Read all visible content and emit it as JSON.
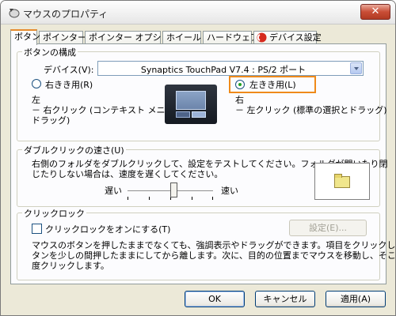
{
  "window": {
    "title": "マウスのプロパティ",
    "close_label": "✕"
  },
  "tabs": [
    {
      "label": "ボタン",
      "active": true
    },
    {
      "label": "ポインター"
    },
    {
      "label": "ポインター オプション"
    },
    {
      "label": "ホイール"
    },
    {
      "label": "ハードウェア"
    },
    {
      "label": "デバイス設定"
    }
  ],
  "buttons_group": {
    "legend": "ボタンの構成",
    "device_label": "デバイス(V):",
    "device_value": "Synaptics TouchPad V7.4 : PS/2 ポート",
    "right_handed_label": "右きき用(R)",
    "left_handed_label": "左きき用(L)",
    "left_mapping_title": "左",
    "left_mapping_line1": "－ 右クリック (コンテキスト メニューと補助",
    "left_mapping_line2": "ドラッグ)",
    "right_mapping_title": "右",
    "right_mapping_line1": "－ 左クリック (標準の選択とドラッグ)"
  },
  "double_click": {
    "legend": "ダブルクリックの速さ(U)",
    "description_line1": "右側のフォルダをダブルクリックして、設定をテストしてください。フォルダが開いたり閉",
    "description_line2": "じたりしない場合は、速度を遅くしてください。",
    "slow_label": "遅い",
    "fast_label": "速い",
    "speed_fraction": 0.55
  },
  "click_lock": {
    "legend": "クリックロック",
    "checkbox_label": "クリックロックをオンにする(T)",
    "settings_button": "設定(E)...",
    "description_line1": "マウスのボタンを押したままでなくても、強調表示やドラッグができます。項目をクリックし、マウスのボ",
    "description_line2": "タンを少しの間押したままにしてから離します。次に、目的の位置までマウスを移動し、そこでもう一",
    "description_line3": "度クリックします。"
  },
  "footer": {
    "ok": "OK",
    "cancel": "キャンセル",
    "apply": "適用(A)"
  },
  "colors": {
    "highlight_border": "#ef8a1a",
    "title_close": "#c94d36"
  }
}
